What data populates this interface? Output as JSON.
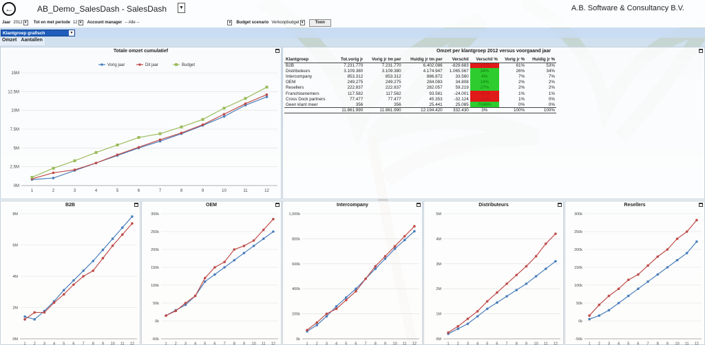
{
  "app": {
    "title": "AB_Demo_SalesDash - SalesDash",
    "company": "A.B. Software & Consultancy B.V."
  },
  "filters": {
    "jaar_label": "Jaar",
    "jaar_value": "2012",
    "periode_label": "Tot en met periode",
    "periode_value": "12",
    "manager_label": "Account manager",
    "manager_value": "-- Alle --",
    "budget_label": "Budget scenario",
    "budget_value": "Verkoopbudget",
    "toon_label": "Toon"
  },
  "group_select": {
    "value": "Klantgroep grafisch"
  },
  "tabs": [
    "Omzet",
    "Aantallen"
  ],
  "colors": {
    "vorig": "#4a7ebb",
    "dit": "#be4b48",
    "budget": "#9bbb59",
    "red": "#e01919",
    "green": "#2ecc2e"
  },
  "omzet_table": {
    "title": "Omzet per klantgroep 2012 versus voorgaand jaar",
    "headers": [
      "Klantgroep",
      "Tot.vorig jr",
      "Vorig jr tm per",
      "Huidig jr tm per",
      "Verschil",
      "Verschil %",
      "Vorig jr %",
      "Huidig jr %"
    ],
    "rows": [
      {
        "name": "B2B",
        "tot": "7.231.770",
        "vorig": "7.231.770",
        "huidig": "6.402.086",
        "verschil": "-829.683",
        "pct": "-11%",
        "status": "red",
        "vpct": "61%",
        "hpct": "53%"
      },
      {
        "name": "Distributeurs",
        "tot": "3.109.380",
        "vorig": "3.109.380",
        "huidig": "4.174.947",
        "verschil": "1.065.567",
        "pct": "34%",
        "status": "green",
        "vpct": "26%",
        "hpct": "34%"
      },
      {
        "name": "Intercompany",
        "tot": "853.312",
        "vorig": "853.312",
        "huidig": "886.872",
        "verschil": "33.560",
        "pct": "4%",
        "status": "green",
        "vpct": "7%",
        "hpct": "7%"
      },
      {
        "name": "OEM",
        "tot": "249.275",
        "vorig": "249.275",
        "huidig": "284.083",
        "verschil": "34.808",
        "pct": "14%",
        "status": "green",
        "vpct": "2%",
        "hpct": "2%"
      },
      {
        "name": "Resellers",
        "tot": "222.837",
        "vorig": "222.837",
        "huidig": "282.057",
        "verschil": "59.219",
        "pct": "27%",
        "status": "green",
        "vpct": "2%",
        "hpct": "2%"
      },
      {
        "name": "Franchisenemers",
        "tot": "117.582",
        "vorig": "117.582",
        "huidig": "93.581",
        "verschil": "-24.001",
        "pct": "-20%",
        "status": "red",
        "vpct": "1%",
        "hpct": "1%"
      },
      {
        "name": "Cross Dock partners",
        "tot": "77.477",
        "vorig": "77.477",
        "huidig": "45.353",
        "verschil": "-32.124",
        "pct": "-41%",
        "status": "red",
        "vpct": "1%",
        "hpct": "0%"
      },
      {
        "name": "Geen klant meer",
        "tot": "356",
        "vorig": "356",
        "huidig": "25.441",
        "verschil": "25.085",
        "pct": "7046%",
        "status": "green",
        "vpct": "0%",
        "hpct": "0%"
      }
    ],
    "total": {
      "name": "",
      "tot": "11.861.990",
      "vorig": "11.861.990",
      "huidig": "12.194.420",
      "verschil": "332.430",
      "pct": "3%",
      "vpct": "100%",
      "hpct": "100%"
    }
  },
  "chart_data": [
    {
      "id": "cumulatief",
      "type": "line",
      "title": "Totale omzet cumulatief",
      "x": [
        1,
        2,
        3,
        4,
        5,
        6,
        7,
        8,
        9,
        10,
        11,
        12
      ],
      "yticks": [
        "0M",
        "2.5M",
        "5M",
        "7.5M",
        "10M",
        "12.5M",
        "15M"
      ],
      "ylim": [
        0,
        15000000
      ],
      "legend": "top",
      "series": [
        {
          "name": "Vorig jaar",
          "color": "#4a7ebb",
          "values": [
            800000,
            1000000,
            2000000,
            3000000,
            4000000,
            5000000,
            5900000,
            6900000,
            8000000,
            9200000,
            10700000,
            11800000
          ]
        },
        {
          "name": "Dit jaar",
          "color": "#be4b48",
          "values": [
            900000,
            1700000,
            2100000,
            3000000,
            4100000,
            5100000,
            6100000,
            7000000,
            8100000,
            9500000,
            10900000,
            12100000
          ]
        },
        {
          "name": "Budget",
          "color": "#9bbb59",
          "values": [
            1100000,
            2300000,
            3300000,
            4400000,
            5400000,
            6400000,
            6900000,
            7800000,
            8800000,
            10300000,
            11600000,
            13100000
          ]
        }
      ]
    },
    {
      "id": "b2b",
      "type": "line",
      "title": "B2B",
      "x": [
        1,
        2,
        3,
        4,
        5,
        6,
        7,
        8,
        9,
        10,
        11,
        12
      ],
      "yticks": [
        "0M",
        "2M",
        "4M",
        "6M",
        "8M"
      ],
      "ylim": [
        -1000000,
        8000000
      ],
      "series": [
        {
          "name": "",
          "color": "#4a7ebb",
          "values": [
            600000,
            400000,
            1000000,
            1700000,
            2500000,
            3200000,
            3900000,
            4600000,
            5400000,
            6200000,
            7000000,
            7800000
          ]
        },
        {
          "name": "",
          "color": "#be4b48",
          "values": [
            400000,
            900000,
            900000,
            1600000,
            2200000,
            2900000,
            3500000,
            3900000,
            4800000,
            5700000,
            6500000,
            7300000
          ]
        }
      ]
    },
    {
      "id": "oem",
      "type": "line",
      "title": "OEM",
      "x": [
        1,
        2,
        3,
        4,
        5,
        6,
        7,
        8,
        9,
        10,
        11,
        12
      ],
      "yticks": [
        "-50k",
        "0k",
        "50k",
        "100k",
        "150k",
        "200k",
        "250k",
        "300k"
      ],
      "ylim": [
        -50000,
        300000
      ],
      "series": [
        {
          "name": "",
          "color": "#4a7ebb",
          "values": [
            15000,
            30000,
            45000,
            70000,
            110000,
            130000,
            150000,
            170000,
            190000,
            210000,
            230000,
            250000
          ]
        },
        {
          "name": "",
          "color": "#be4b48",
          "values": [
            15000,
            28000,
            50000,
            70000,
            120000,
            150000,
            165000,
            200000,
            210000,
            225000,
            255000,
            285000
          ]
        }
      ]
    },
    {
      "id": "intercompany",
      "type": "line",
      "title": "Intercompany",
      "x": [
        1,
        2,
        3,
        4,
        5,
        6,
        7,
        8,
        9,
        10,
        11,
        12
      ],
      "yticks": [
        "0k",
        "200k",
        "400k",
        "600k",
        "800k",
        "1,000k"
      ],
      "ylim": [
        0,
        1000000
      ],
      "series": [
        {
          "name": "",
          "color": "#4a7ebb",
          "values": [
            60000,
            110000,
            180000,
            260000,
            330000,
            400000,
            480000,
            560000,
            640000,
            720000,
            790000,
            860000
          ]
        },
        {
          "name": "",
          "color": "#be4b48",
          "values": [
            70000,
            130000,
            200000,
            240000,
            310000,
            380000,
            480000,
            580000,
            660000,
            740000,
            820000,
            900000
          ]
        }
      ]
    },
    {
      "id": "distributeurs",
      "type": "line",
      "title": "Distributeurs",
      "x": [
        1,
        2,
        3,
        4,
        5,
        6,
        7,
        8,
        9,
        10,
        11,
        12
      ],
      "yticks": [
        "0M",
        "1M",
        "2M",
        "3M",
        "4M",
        "5M"
      ],
      "ylim": [
        0,
        5000000
      ],
      "series": [
        {
          "name": "",
          "color": "#4a7ebb",
          "values": [
            200000,
            400000,
            600000,
            900000,
            1200000,
            1450000,
            1700000,
            1950000,
            2200000,
            2500000,
            2800000,
            3100000
          ]
        },
        {
          "name": "",
          "color": "#be4b48",
          "values": [
            250000,
            500000,
            800000,
            1100000,
            1500000,
            1850000,
            2200000,
            2550000,
            2900000,
            3300000,
            3800000,
            4200000
          ]
        }
      ]
    },
    {
      "id": "resellers",
      "type": "line",
      "title": "Resellers",
      "x": [
        1,
        2,
        3,
        4,
        5,
        6,
        7,
        8,
        9,
        10,
        11,
        12
      ],
      "yticks": [
        "-50k",
        "0k",
        "50k",
        "100k",
        "150k",
        "200k",
        "250k",
        "300k"
      ],
      "ylim": [
        -50000,
        300000
      ],
      "series": [
        {
          "name": "",
          "color": "#4a7ebb",
          "values": [
            5000,
            15000,
            30000,
            50000,
            70000,
            90000,
            110000,
            130000,
            150000,
            170000,
            190000,
            222000
          ]
        },
        {
          "name": "",
          "color": "#be4b48",
          "values": [
            15000,
            45000,
            70000,
            90000,
            115000,
            130000,
            155000,
            180000,
            200000,
            230000,
            250000,
            282000
          ]
        }
      ]
    }
  ]
}
